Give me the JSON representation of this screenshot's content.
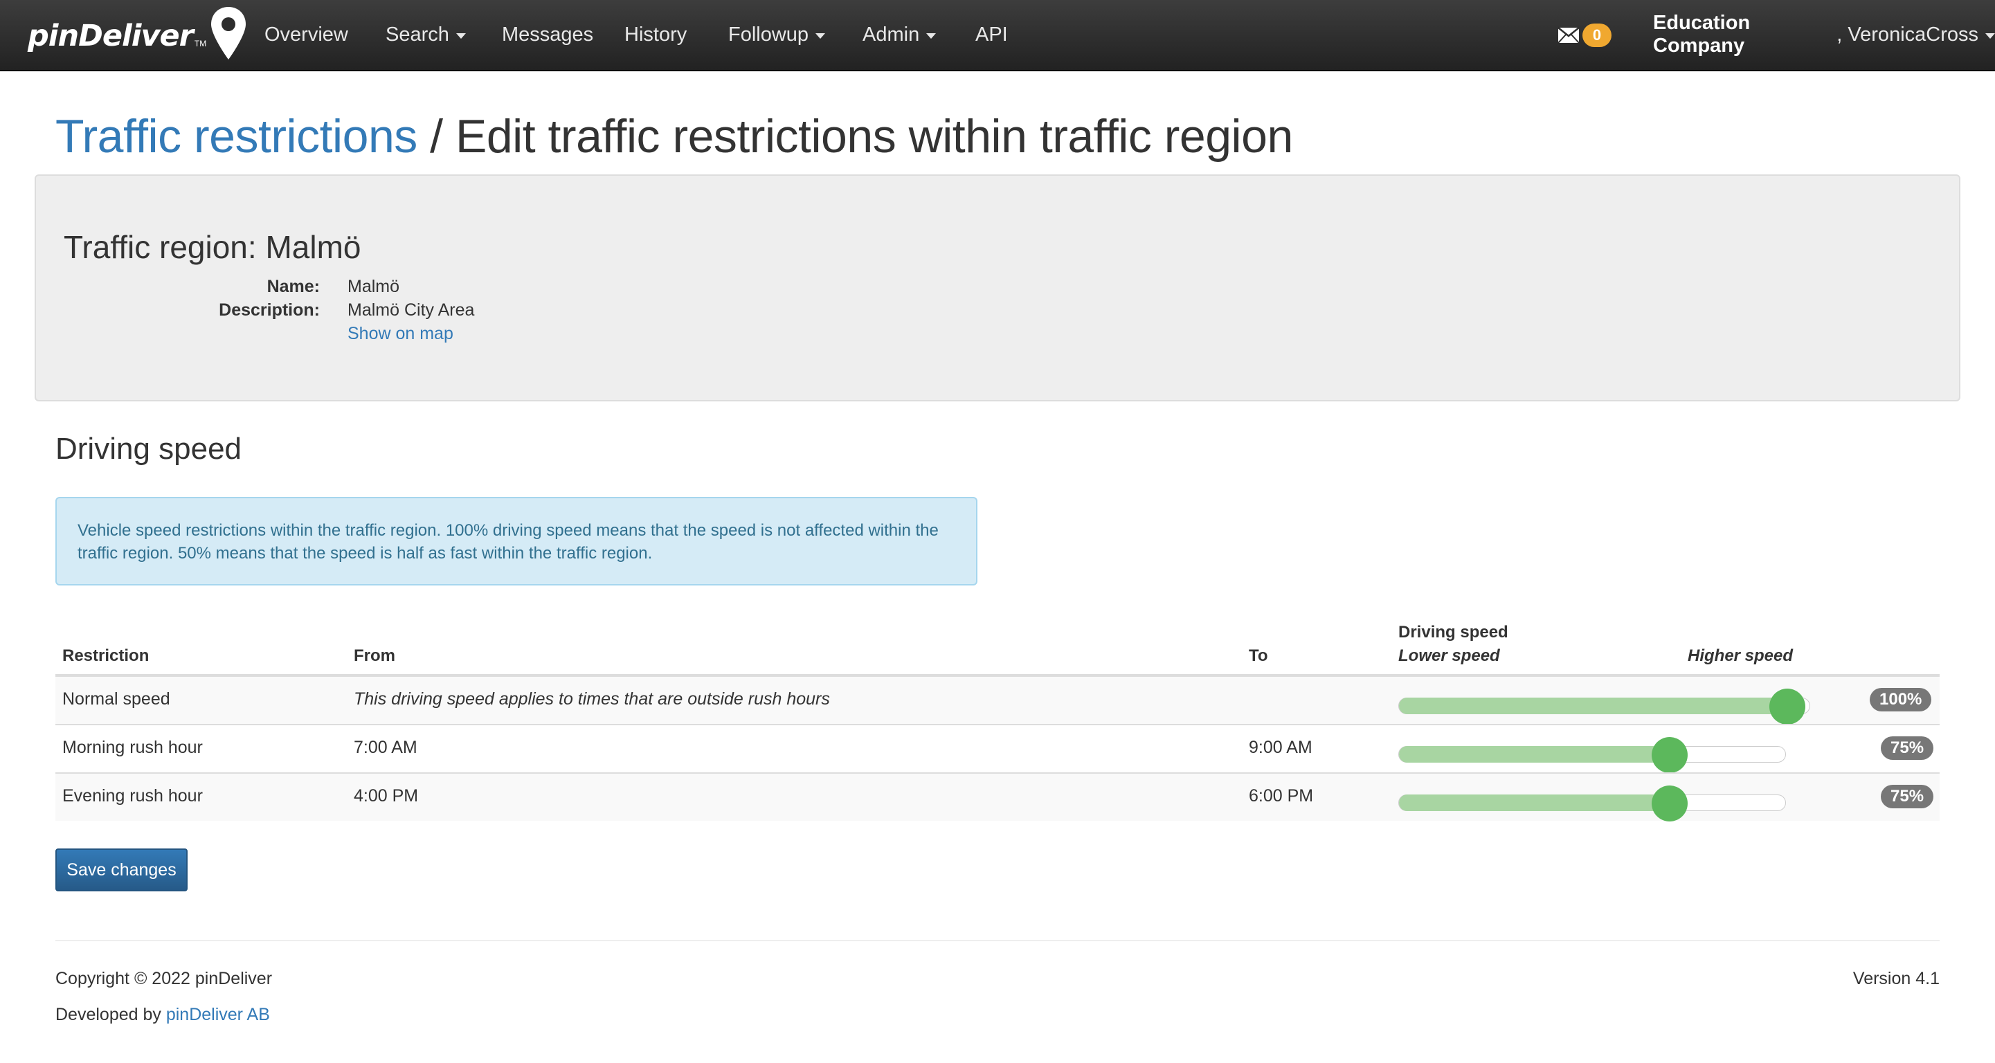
{
  "navbar": {
    "brand": "pinDeliver",
    "brand_tm": "TM",
    "items": [
      {
        "label": "Overview",
        "dropdown": false
      },
      {
        "label": "Search",
        "dropdown": true
      },
      {
        "label": "Messages",
        "dropdown": false
      },
      {
        "label": "History",
        "dropdown": false
      },
      {
        "label": "Followup",
        "dropdown": true
      },
      {
        "label": "Admin",
        "dropdown": true
      },
      {
        "label": "API",
        "dropdown": false
      }
    ],
    "mail_count": "0",
    "user_company": "Education Company",
    "user_separator": ", ",
    "user_name": "VeronicaCross"
  },
  "heading": {
    "breadcrumb_link": "Traffic restrictions",
    "separator": " / ",
    "title": "Edit traffic restrictions within traffic region"
  },
  "region": {
    "title": "Traffic region: Malmö",
    "name_label": "Name:",
    "name_value": "Malmö",
    "description_label": "Description:",
    "description_value": "Malmö City Area",
    "map_link": "Show on map"
  },
  "driving_speed": {
    "section_title": "Driving speed",
    "info": "Vehicle speed restrictions within the traffic region. 100% driving speed means that the speed is not affected within the traffic region. 50% means that the speed is half as fast within the traffic region."
  },
  "table": {
    "headers": {
      "restriction": "Restriction",
      "from": "From",
      "to": "To",
      "driving_speed": "Driving speed",
      "lower_speed": "Lower speed",
      "higher_speed": "Higher speed"
    },
    "rows": [
      {
        "restriction": "Normal speed",
        "from": "This driving speed applies to times that are outside rush hours",
        "from_italic": true,
        "to": "",
        "speed": 100,
        "speed_label": "100%"
      },
      {
        "restriction": "Morning rush hour",
        "from": "7:00 AM",
        "from_italic": false,
        "to": "9:00 AM",
        "speed": 75,
        "speed_label": "75%"
      },
      {
        "restriction": "Evening rush hour",
        "from": "4:00 PM",
        "from_italic": false,
        "to": "6:00 PM",
        "speed": 75,
        "speed_label": "75%"
      }
    ]
  },
  "save_button": "Save changes",
  "footer": {
    "copyright": "Copyright © 2022 pinDeliver",
    "developed_by": "Developed by ",
    "developer_link": "pinDeliver AB",
    "version": "Version 4.1"
  },
  "colors": {
    "link": "#337ab7",
    "slider_handle": "#5cb85c",
    "slider_fill": "#a8d5a2",
    "badge_mail": "#f0a830",
    "badge_pct": "#777777"
  }
}
